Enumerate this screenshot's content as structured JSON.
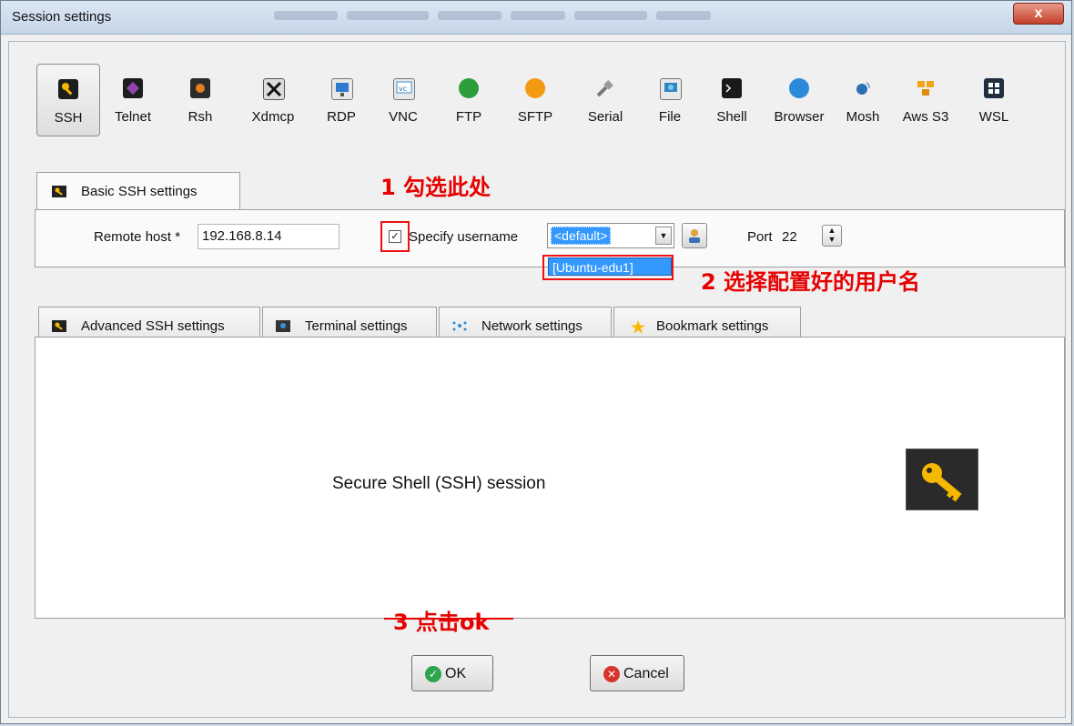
{
  "window": {
    "title": "Session settings",
    "close_glyph": "x"
  },
  "protocols": [
    {
      "label": "SSH",
      "icon": "ssh-key-icon",
      "color": "#1d1d1d",
      "selected": true
    },
    {
      "label": "Telnet",
      "icon": "telnet-icon",
      "color": "#6a2b8f"
    },
    {
      "label": "Rsh",
      "icon": "rsh-icon",
      "color": "#3a3a3a"
    },
    {
      "label": "Xdmcp",
      "icon": "xdmcp-icon",
      "color": "#444444"
    },
    {
      "label": "RDP",
      "icon": "rdp-monitor-icon",
      "color": "#2d7bd0"
    },
    {
      "label": "VNC",
      "icon": "vnc-icon",
      "color": "#3a8fd6"
    },
    {
      "label": "FTP",
      "icon": "ftp-globe-icon",
      "color": "#2e9e3a"
    },
    {
      "label": "SFTP",
      "icon": "sftp-globe-icon",
      "color": "#f39a12"
    },
    {
      "label": "Serial",
      "icon": "serial-plug-icon",
      "color": "#777777"
    },
    {
      "label": "File",
      "icon": "file-monitor-icon",
      "color": "#2f87c7"
    },
    {
      "label": "Shell",
      "icon": "shell-terminal-icon",
      "color": "#1a1a1a"
    },
    {
      "label": "Browser",
      "icon": "browser-globe-icon",
      "color": "#2b8ad9"
    },
    {
      "label": "Mosh",
      "icon": "mosh-satellite-icon",
      "color": "#2b6fb6"
    },
    {
      "label": "Aws S3",
      "icon": "aws-s3-icon",
      "color": "#f2a51a"
    },
    {
      "label": "WSL",
      "icon": "wsl-windows-icon",
      "color": "#1f2f3f"
    }
  ],
  "basic": {
    "tab_label": "Basic SSH settings",
    "remote_host_label": "Remote host *",
    "remote_host_value": "192.168.8.14",
    "specify_username_checked": true,
    "specify_username_label": "Specify username",
    "username_value": "<default>",
    "dropdown_option": "[Ubuntu-edu1]",
    "port_label": "Port",
    "port_value": "22"
  },
  "tabs": [
    {
      "label": "Advanced SSH settings",
      "icon": "key-icon"
    },
    {
      "label": "Terminal settings",
      "icon": "terminal-icon"
    },
    {
      "label": "Network settings",
      "icon": "network-icon"
    },
    {
      "label": "Bookmark settings",
      "icon": "star-icon"
    }
  ],
  "main": {
    "description": "Secure Shell (SSH) session"
  },
  "annotations": {
    "step1": "1 勾选此处",
    "step2": "2 选择配置好的用户名",
    "step3": "3 点击ok"
  },
  "buttons": {
    "ok": "OK",
    "cancel": "Cancel"
  },
  "colors": {
    "annotation_red": "#e60000",
    "selection_blue": "#3399ff"
  }
}
